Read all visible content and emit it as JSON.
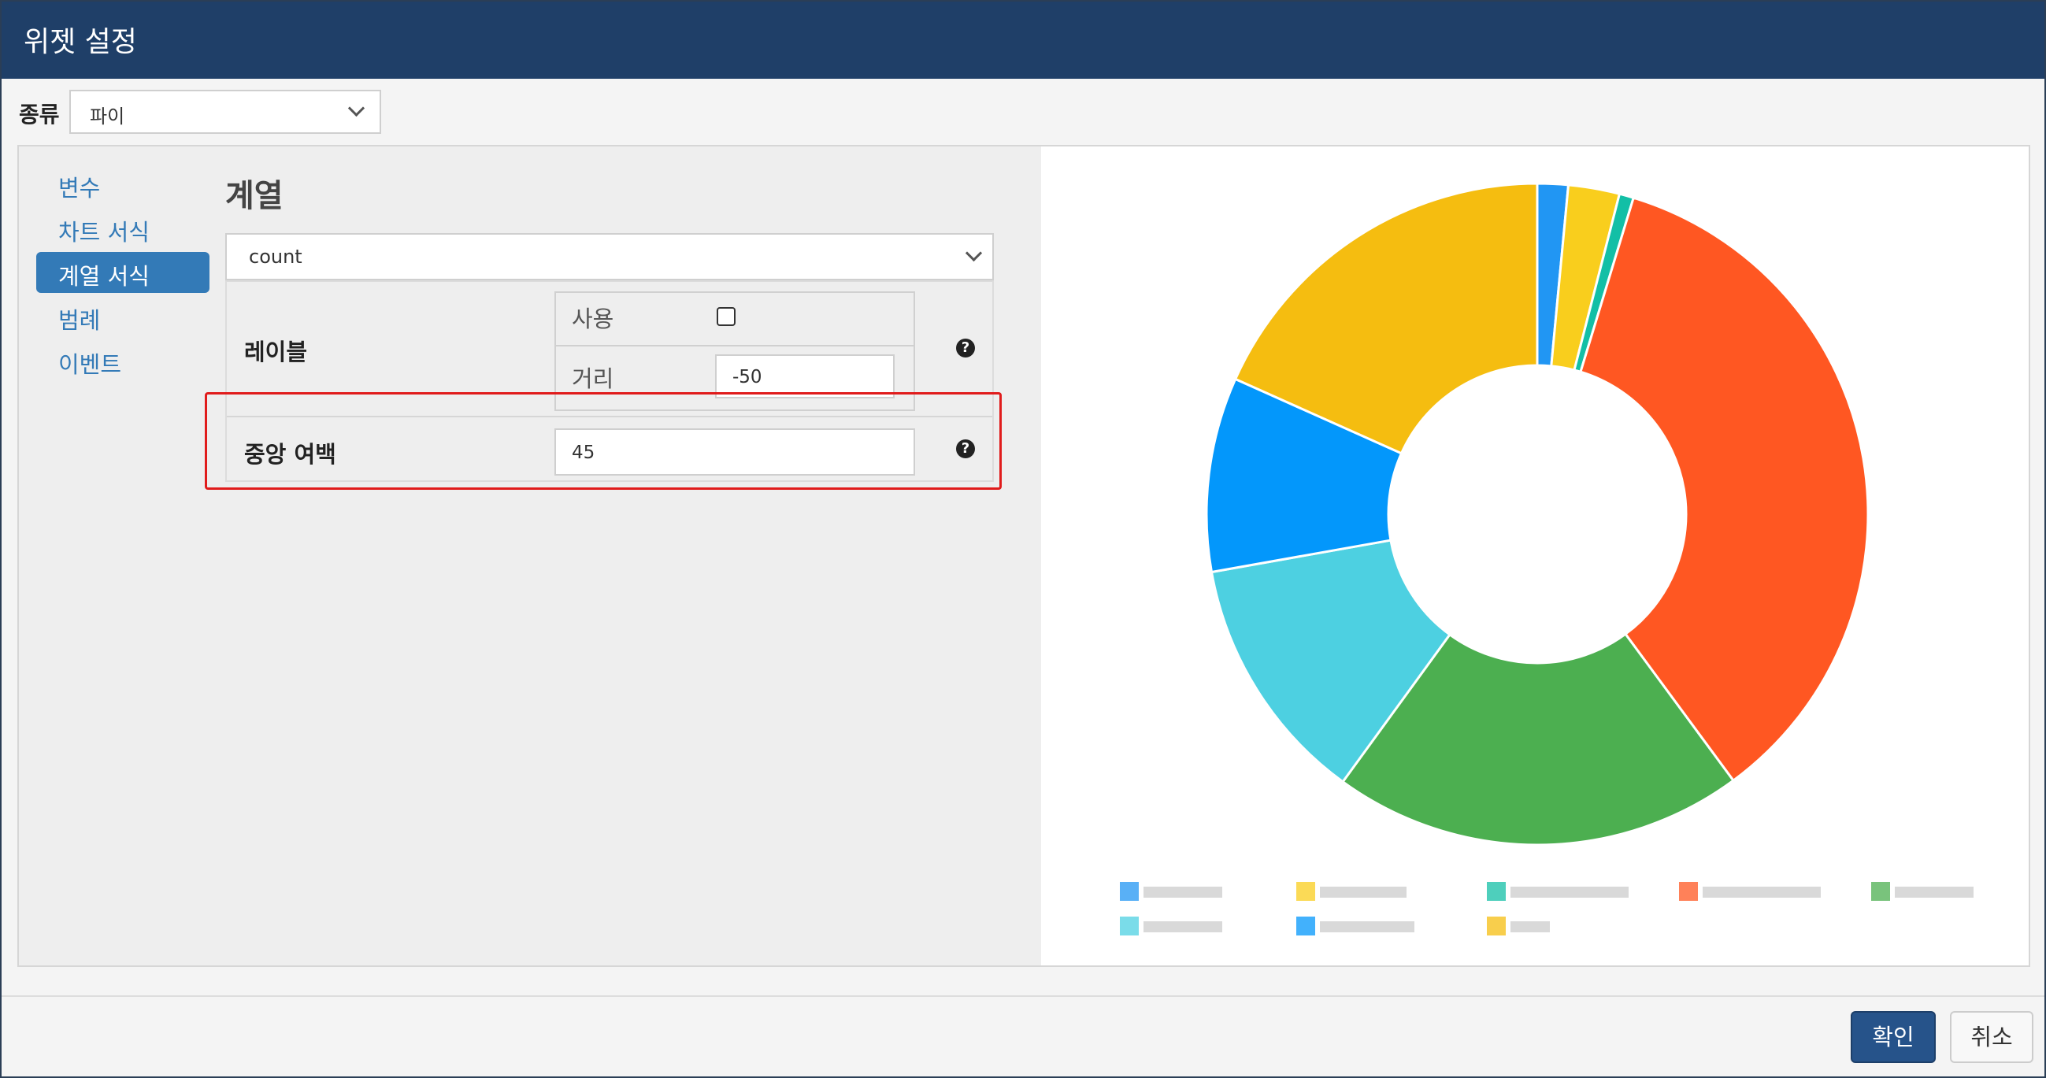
{
  "dialog": {
    "title": "위젯 설정"
  },
  "type_field": {
    "label": "종류",
    "value": "파이"
  },
  "nav": {
    "items": [
      "변수",
      "차트 서식",
      "계열 서식",
      "범례",
      "이벤트"
    ],
    "active": "계열 서식"
  },
  "section": {
    "title": "계열",
    "series_value": "count",
    "label_row": {
      "label": "레이블",
      "use_label": "사용",
      "use_checked": false,
      "distance_label": "거리",
      "distance_value": "-50"
    },
    "center_row": {
      "label": "중앙 여백",
      "value": "45"
    }
  },
  "colors": {
    "accent": "#337ab7",
    "titlebar": "#1f3f68",
    "highlight": "#e01b1b"
  },
  "chart_data": {
    "type": "pie",
    "inner_radius_percent": 45,
    "categories": [
      "",
      "",
      "",
      "",
      "",
      "",
      "",
      ""
    ],
    "values": [
      1.5,
      2.5,
      0.7,
      35.2,
      20.1,
      12.2,
      9.5,
      18.3
    ],
    "colors": [
      "#2196f3",
      "#f9ce1d",
      "#13bfa6",
      "#ff5722",
      "#4caf50",
      "#4dd0e1",
      "#0397fb",
      "#f5bd10"
    ]
  },
  "buttons": {
    "ok": "확인",
    "cancel": "취소"
  }
}
